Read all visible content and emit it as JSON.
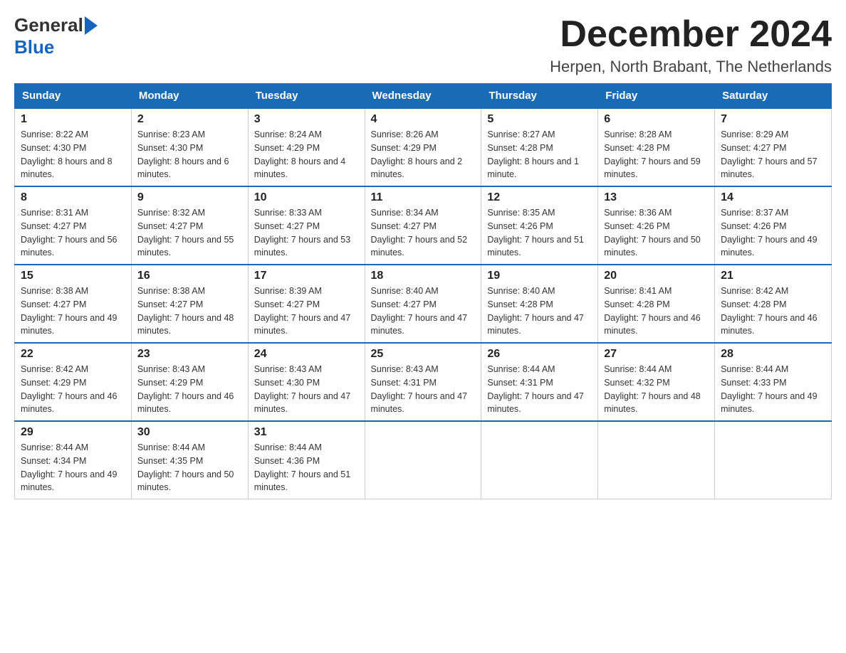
{
  "logo": {
    "general": "General",
    "blue": "Blue"
  },
  "title": {
    "month_year": "December 2024",
    "location": "Herpen, North Brabant, The Netherlands"
  },
  "weekdays": [
    "Sunday",
    "Monday",
    "Tuesday",
    "Wednesday",
    "Thursday",
    "Friday",
    "Saturday"
  ],
  "weeks": [
    [
      {
        "day": "1",
        "sunrise": "8:22 AM",
        "sunset": "4:30 PM",
        "daylight": "8 hours and 8 minutes."
      },
      {
        "day": "2",
        "sunrise": "8:23 AM",
        "sunset": "4:30 PM",
        "daylight": "8 hours and 6 minutes."
      },
      {
        "day": "3",
        "sunrise": "8:24 AM",
        "sunset": "4:29 PM",
        "daylight": "8 hours and 4 minutes."
      },
      {
        "day": "4",
        "sunrise": "8:26 AM",
        "sunset": "4:29 PM",
        "daylight": "8 hours and 2 minutes."
      },
      {
        "day": "5",
        "sunrise": "8:27 AM",
        "sunset": "4:28 PM",
        "daylight": "8 hours and 1 minute."
      },
      {
        "day": "6",
        "sunrise": "8:28 AM",
        "sunset": "4:28 PM",
        "daylight": "7 hours and 59 minutes."
      },
      {
        "day": "7",
        "sunrise": "8:29 AM",
        "sunset": "4:27 PM",
        "daylight": "7 hours and 57 minutes."
      }
    ],
    [
      {
        "day": "8",
        "sunrise": "8:31 AM",
        "sunset": "4:27 PM",
        "daylight": "7 hours and 56 minutes."
      },
      {
        "day": "9",
        "sunrise": "8:32 AM",
        "sunset": "4:27 PM",
        "daylight": "7 hours and 55 minutes."
      },
      {
        "day": "10",
        "sunrise": "8:33 AM",
        "sunset": "4:27 PM",
        "daylight": "7 hours and 53 minutes."
      },
      {
        "day": "11",
        "sunrise": "8:34 AM",
        "sunset": "4:27 PM",
        "daylight": "7 hours and 52 minutes."
      },
      {
        "day": "12",
        "sunrise": "8:35 AM",
        "sunset": "4:26 PM",
        "daylight": "7 hours and 51 minutes."
      },
      {
        "day": "13",
        "sunrise": "8:36 AM",
        "sunset": "4:26 PM",
        "daylight": "7 hours and 50 minutes."
      },
      {
        "day": "14",
        "sunrise": "8:37 AM",
        "sunset": "4:26 PM",
        "daylight": "7 hours and 49 minutes."
      }
    ],
    [
      {
        "day": "15",
        "sunrise": "8:38 AM",
        "sunset": "4:27 PM",
        "daylight": "7 hours and 49 minutes."
      },
      {
        "day": "16",
        "sunrise": "8:38 AM",
        "sunset": "4:27 PM",
        "daylight": "7 hours and 48 minutes."
      },
      {
        "day": "17",
        "sunrise": "8:39 AM",
        "sunset": "4:27 PM",
        "daylight": "7 hours and 47 minutes."
      },
      {
        "day": "18",
        "sunrise": "8:40 AM",
        "sunset": "4:27 PM",
        "daylight": "7 hours and 47 minutes."
      },
      {
        "day": "19",
        "sunrise": "8:40 AM",
        "sunset": "4:28 PM",
        "daylight": "7 hours and 47 minutes."
      },
      {
        "day": "20",
        "sunrise": "8:41 AM",
        "sunset": "4:28 PM",
        "daylight": "7 hours and 46 minutes."
      },
      {
        "day": "21",
        "sunrise": "8:42 AM",
        "sunset": "4:28 PM",
        "daylight": "7 hours and 46 minutes."
      }
    ],
    [
      {
        "day": "22",
        "sunrise": "8:42 AM",
        "sunset": "4:29 PM",
        "daylight": "7 hours and 46 minutes."
      },
      {
        "day": "23",
        "sunrise": "8:43 AM",
        "sunset": "4:29 PM",
        "daylight": "7 hours and 46 minutes."
      },
      {
        "day": "24",
        "sunrise": "8:43 AM",
        "sunset": "4:30 PM",
        "daylight": "7 hours and 47 minutes."
      },
      {
        "day": "25",
        "sunrise": "8:43 AM",
        "sunset": "4:31 PM",
        "daylight": "7 hours and 47 minutes."
      },
      {
        "day": "26",
        "sunrise": "8:44 AM",
        "sunset": "4:31 PM",
        "daylight": "7 hours and 47 minutes."
      },
      {
        "day": "27",
        "sunrise": "8:44 AM",
        "sunset": "4:32 PM",
        "daylight": "7 hours and 48 minutes."
      },
      {
        "day": "28",
        "sunrise": "8:44 AM",
        "sunset": "4:33 PM",
        "daylight": "7 hours and 49 minutes."
      }
    ],
    [
      {
        "day": "29",
        "sunrise": "8:44 AM",
        "sunset": "4:34 PM",
        "daylight": "7 hours and 49 minutes."
      },
      {
        "day": "30",
        "sunrise": "8:44 AM",
        "sunset": "4:35 PM",
        "daylight": "7 hours and 50 minutes."
      },
      {
        "day": "31",
        "sunrise": "8:44 AM",
        "sunset": "4:36 PM",
        "daylight": "7 hours and 51 minutes."
      },
      null,
      null,
      null,
      null
    ]
  ]
}
